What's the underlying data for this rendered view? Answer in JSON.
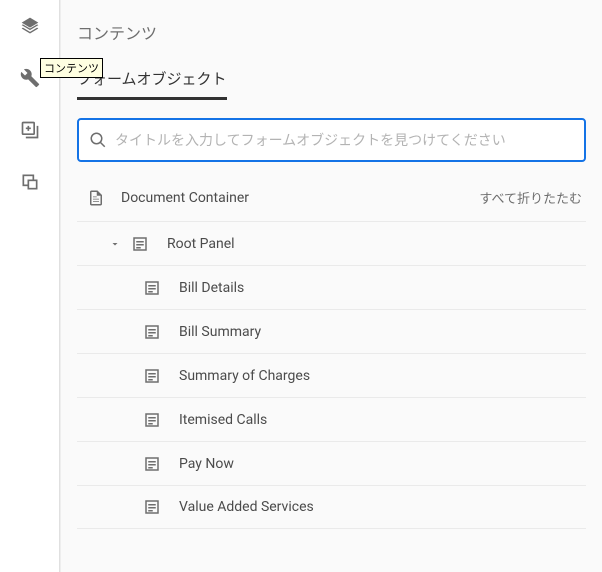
{
  "rail": {
    "tooltip": "コンテンツ"
  },
  "panel": {
    "title": "コンテンツ",
    "tab": "フォームオブジェクト",
    "search_placeholder": "タイトルを入力してフォームオブジェクトを見つけてください",
    "collapse_all": "すべて折りたたむ",
    "document_container": "Document Container",
    "root_panel": "Root Panel",
    "children": [
      {
        "label": "Bill Details"
      },
      {
        "label": "Bill Summary"
      },
      {
        "label": "Summary of Charges"
      },
      {
        "label": "Itemised Calls"
      },
      {
        "label": "Pay Now"
      },
      {
        "label": "Value Added Services"
      }
    ]
  }
}
